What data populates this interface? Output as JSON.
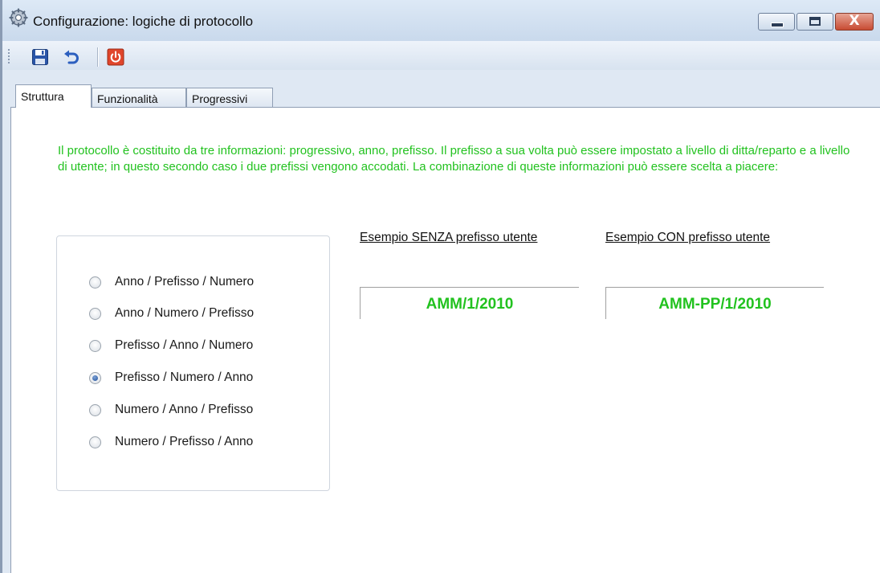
{
  "window": {
    "title": "Configurazione: logiche di protocollo",
    "icon": "gear-icon",
    "controls": {
      "minimize": "minimize",
      "maximize": "maximize",
      "close": "X"
    }
  },
  "toolbar": {
    "items": [
      {
        "name": "save",
        "icon": "floppy-disk-icon"
      },
      {
        "name": "undo",
        "icon": "undo-arrow-icon"
      },
      {
        "name": "exit",
        "icon": "power-icon"
      }
    ]
  },
  "tabs": [
    {
      "label": "Struttura",
      "active": true
    },
    {
      "label": "Funzionalità",
      "active": false
    },
    {
      "label": "Progressivi",
      "active": false
    }
  ],
  "description": "Il protocollo è costituito da tre informazioni: progressivo, anno, prefisso. Il prefisso a sua volta può essere impostato a livello di ditta/reparto e a livello di utente; in questo secondo caso i due prefissi vengono accodati. La combinazione di queste informazioni può essere scelta a piacere:",
  "options": [
    {
      "label": "Anno / Prefisso / Numero",
      "checked": false
    },
    {
      "label": "Anno / Numero / Prefisso",
      "checked": false
    },
    {
      "label": "Prefisso / Anno / Numero",
      "checked": false
    },
    {
      "label": "Prefisso / Numero / Anno",
      "checked": true
    },
    {
      "label": "Numero / Anno / Prefisso",
      "checked": false
    },
    {
      "label": "Numero / Prefisso / Anno",
      "checked": false
    }
  ],
  "examples": {
    "without_label": "Esempio SENZA prefisso utente",
    "without_value": "AMM/1/2010",
    "with_label": "Esempio CON prefisso utente",
    "with_value": "AMM-PP/1/2010"
  },
  "colors": {
    "accent_green": "#22c21f",
    "window_frame": "#dfe8f3",
    "close_red": "#c84b33"
  }
}
